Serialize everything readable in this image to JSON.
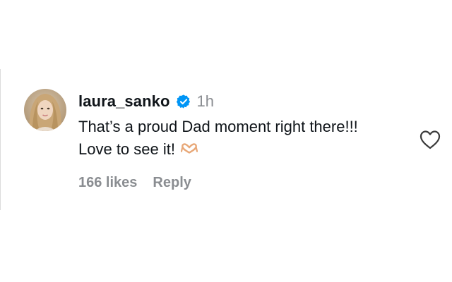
{
  "comment": {
    "username": "laura_sanko",
    "verified": true,
    "timestamp": "1h",
    "text": "That’s a proud Dad moment right there!!! Love to see it!",
    "emoji": "heart-hands-emoji",
    "likes_label": "166 likes",
    "reply_label": "Reply",
    "like_icon": "heart-outline-icon",
    "colors": {
      "verified_badge": "#0095f6",
      "muted_text": "#8a8d91",
      "primary_text": "#0f1419"
    }
  }
}
